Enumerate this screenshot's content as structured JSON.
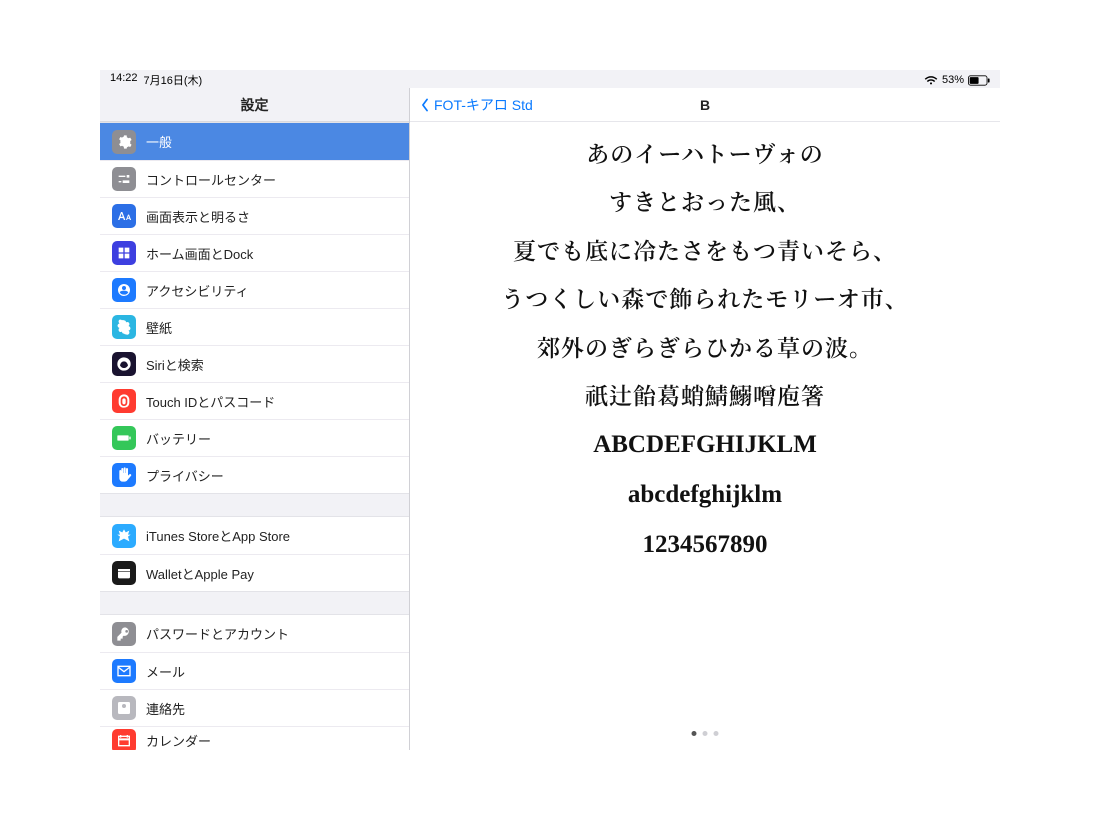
{
  "status": {
    "time": "14:22",
    "date": "7月16日(木)",
    "battery_pct": "53%",
    "wifi_icon": "wifi",
    "battery_icon": "battery"
  },
  "sidebar": {
    "title": "設定",
    "groups": [
      {
        "items": [
          {
            "id": "general",
            "label": "一般",
            "icon": "gear",
            "color": "#8e8e93",
            "selected": true
          },
          {
            "id": "control-center",
            "label": "コントロールセンター",
            "icon": "sliders",
            "color": "#8e8e93"
          },
          {
            "id": "display",
            "label": "画面表示と明るさ",
            "icon": "aa",
            "color": "#2c6fe6"
          },
          {
            "id": "home-dock",
            "label": "ホーム画面とDock",
            "icon": "grid",
            "color": "#3d3fe0"
          },
          {
            "id": "accessibility",
            "label": "アクセシビリティ",
            "icon": "person",
            "color": "#1d7aff"
          },
          {
            "id": "wallpaper",
            "label": "壁紙",
            "icon": "flower",
            "color": "#2bb6e2"
          },
          {
            "id": "siri",
            "label": "Siriと検索",
            "icon": "siri",
            "color": "#1a1330"
          },
          {
            "id": "touchid",
            "label": "Touch IDとパスコード",
            "icon": "finger",
            "color": "#ff3b30"
          },
          {
            "id": "battery",
            "label": "バッテリー",
            "icon": "battery",
            "color": "#34c759"
          },
          {
            "id": "privacy",
            "label": "プライバシー",
            "icon": "hand",
            "color": "#1d7aff"
          }
        ]
      },
      {
        "items": [
          {
            "id": "itunes",
            "label": "iTunes StoreとApp Store",
            "icon": "appstore",
            "color": "#2cabff"
          },
          {
            "id": "wallet",
            "label": "WalletとApple Pay",
            "icon": "wallet",
            "color": "#1a1a1a"
          }
        ]
      },
      {
        "items": [
          {
            "id": "passwords",
            "label": "パスワードとアカウント",
            "icon": "key",
            "color": "#8e8e93"
          },
          {
            "id": "mail",
            "label": "メール",
            "icon": "mail",
            "color": "#1d7aff"
          },
          {
            "id": "contacts",
            "label": "連絡先",
            "icon": "contacts",
            "color": "#b8b8be"
          },
          {
            "id": "calendar",
            "label": "カレンダー",
            "icon": "calendar",
            "color": "#ff3b30",
            "cut": true
          }
        ]
      }
    ]
  },
  "detail": {
    "back_label": "FOT-キアロ Std",
    "title": "B",
    "preview_lines": [
      {
        "cls": "jp",
        "text": "あのイーハトーヴォの"
      },
      {
        "cls": "jp",
        "text": "すきとおった風、"
      },
      {
        "cls": "jp",
        "text": "夏でも底に冷たさをもつ青いそら、"
      },
      {
        "cls": "jp",
        "text": "うつくしい森で飾られたモリーオ市、"
      },
      {
        "cls": "jp",
        "text": "郊外のぎらぎらひかる草の波。"
      },
      {
        "cls": "jp",
        "text": "祇辻飴葛蛸鯖鰯噌庖箸"
      },
      {
        "cls": "lat",
        "text": "ABCDEFGHIJKLM"
      },
      {
        "cls": "lat",
        "text": "abcdefghijklm"
      },
      {
        "cls": "num",
        "text": "1234567890"
      }
    ],
    "page_count": 3,
    "active_page": 0
  }
}
